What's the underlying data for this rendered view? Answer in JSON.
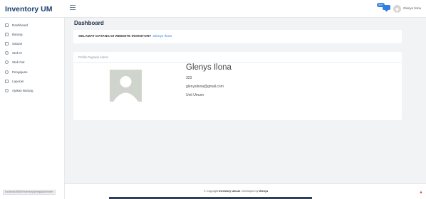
{
  "app": {
    "brand": "Inventory UM"
  },
  "header": {
    "notification_count": "99+",
    "user_name": "Glenys Ilona"
  },
  "sidebar": {
    "items": [
      {
        "label": "Dashboard",
        "icon": "grid-icon"
      },
      {
        "label": "Barang",
        "icon": "box-icon"
      },
      {
        "label": "Satuan",
        "icon": "ruler-icon"
      },
      {
        "label": "Stok In",
        "icon": "arrow-in-icon"
      },
      {
        "label": "Stok Out",
        "icon": "arrow-out-icon"
      },
      {
        "label": "Pengajuan",
        "icon": "document-icon"
      },
      {
        "label": "Laporan",
        "icon": "report-icon"
      },
      {
        "label": "Ajukan Barang",
        "icon": "request-icon"
      }
    ]
  },
  "main": {
    "title": "Dashboard",
    "welcome_label": "SELAMAT DATANG DI WEBSITE INVENTORY",
    "welcome_name": "Glenys Ilona",
    "profile": {
      "header": "Profile Pegawai Admin",
      "name": "Glenys Ilona",
      "id": "323",
      "email": "glenysilona@gmail.com",
      "unit": "Unit Umum"
    }
  },
  "footer": {
    "prefix": "© Copyright",
    "app": "Inventory Umum",
    "middle": ". Developed by",
    "dev": "Glenys"
  },
  "status_bar": {
    "url": "localhost:8080/inventory/pengajuan/index"
  },
  "colors": {
    "accent": "#2f7fe0",
    "brand": "#1d3f6e",
    "background": "#f2f3f5"
  }
}
